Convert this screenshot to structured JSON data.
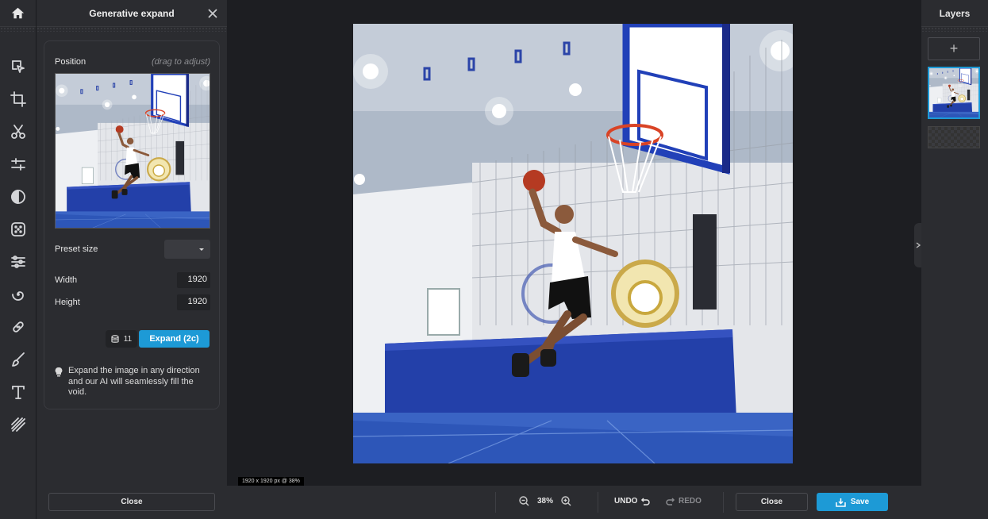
{
  "panel": {
    "title": "Generative expand",
    "position_label": "Position",
    "position_hint": "(drag to adjust)",
    "preset_label": "Preset size",
    "preset_value": "",
    "width_label": "Width",
    "width_value": "1920",
    "height_label": "Height",
    "height_value": "1920",
    "credits": "11",
    "expand_label": "Expand (2c)",
    "tip": "Expand the image in any direction and our AI will seamlessly fill the void.",
    "close_label": "Close"
  },
  "canvas": {
    "dimensions": "1920 x 1920 px @ 38%"
  },
  "layers": {
    "title": "Layers",
    "add_label": "+"
  },
  "bottombar": {
    "zoom_value": "38%",
    "undo_label": "UNDO",
    "redo_label": "REDO",
    "close_label": "Close",
    "save_label": "Save"
  },
  "colors": {
    "accent": "#1d9ad6",
    "panel_bg": "#2b2c30",
    "canvas_bg": "#1d1e22"
  },
  "tools": [
    "select-tool",
    "crop-tool",
    "cutout-tool",
    "adjust-tool",
    "filter-tool",
    "effects-tool",
    "adjust-sliders-tool",
    "liquify-tool",
    "retouch-tool",
    "brush-tool",
    "text-tool",
    "texture-tool"
  ]
}
